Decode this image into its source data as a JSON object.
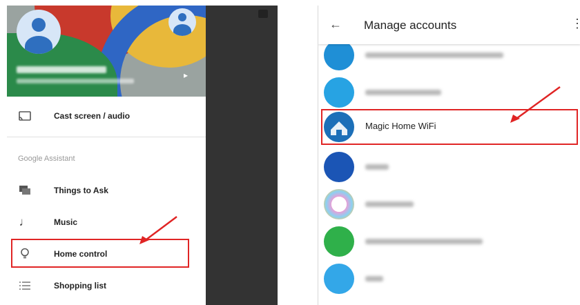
{
  "left": {
    "menu": [
      {
        "id": "cast",
        "label": "Cast screen / audio",
        "icon": "cast-icon"
      },
      {
        "id": "things",
        "label": "Things to Ask",
        "icon": "chat-icon"
      },
      {
        "id": "music",
        "label": "Music",
        "icon": "music-note-icon"
      },
      {
        "id": "home",
        "label": "Home control",
        "icon": "lightbulb-icon"
      },
      {
        "id": "shopping",
        "label": "Shopping list",
        "icon": "list-icon"
      }
    ],
    "section_label": "Google Assistant"
  },
  "right": {
    "title": "Manage accounts",
    "highlighted_account": "Magic Home WiFi"
  },
  "colors": {
    "highlight": "#e02424",
    "header_red": "#c8392c",
    "header_yellow": "#e8b83a",
    "header_blue": "#2f66c4",
    "header_green": "#2b8a4a"
  }
}
